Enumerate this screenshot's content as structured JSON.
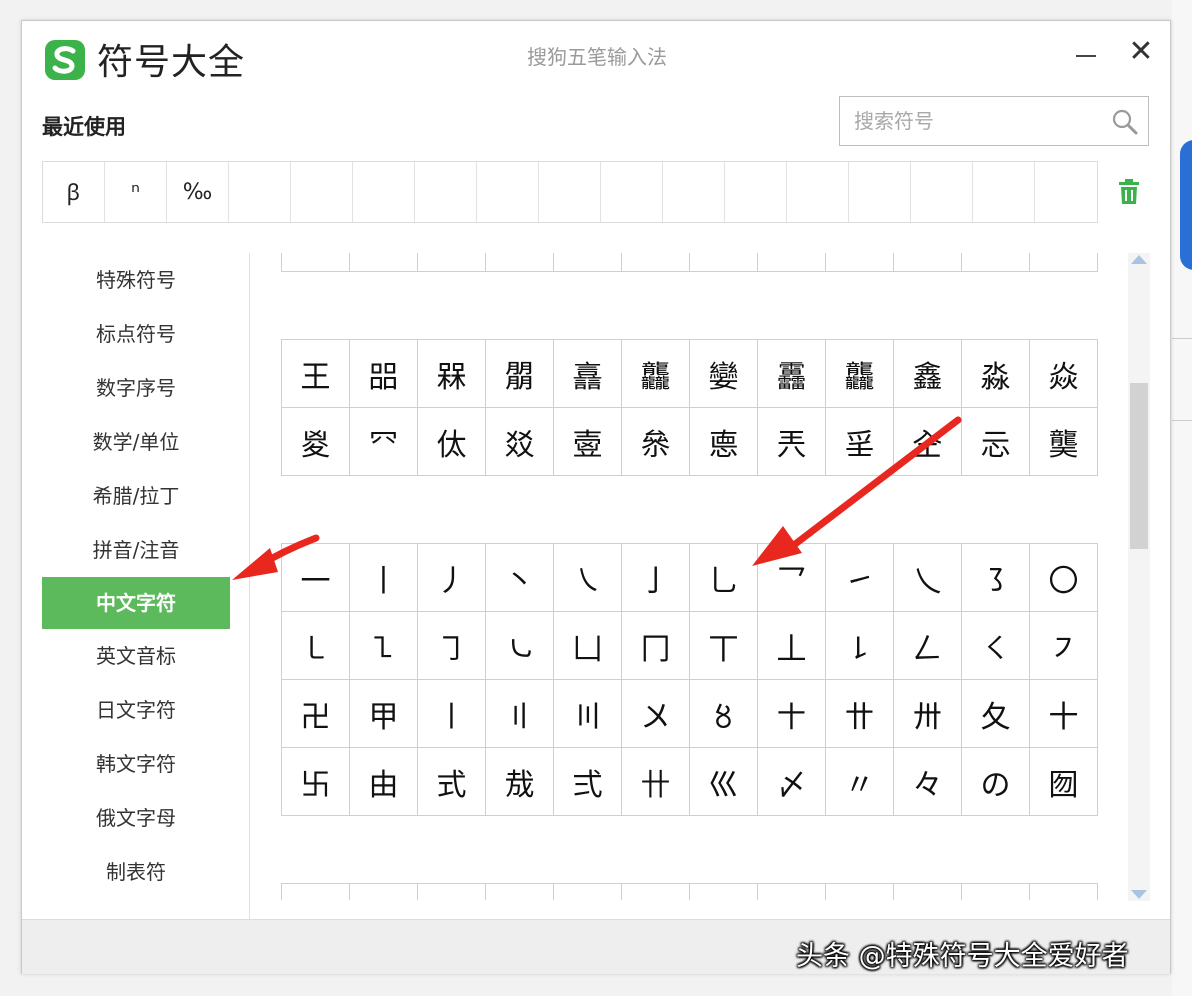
{
  "window": {
    "app_title": "符号大全",
    "ime_name": "搜狗五笔输入法"
  },
  "colors": {
    "accent": "#5cba5c",
    "logo_green": "#3cb34a",
    "arrow": "#e8281f"
  },
  "recent": {
    "title": "最近使用",
    "symbols": [
      "ꞵ",
      "ⁿ",
      "‰",
      "",
      "",
      "",
      "",
      "",
      "",
      "",
      "",
      "",
      "",
      "",
      "",
      "",
      ""
    ]
  },
  "search": {
    "placeholder": "搜索符号"
  },
  "sidebar": {
    "items": [
      {
        "label": "特殊符号"
      },
      {
        "label": "标点符号"
      },
      {
        "label": "数字序号"
      },
      {
        "label": "数学/单位"
      },
      {
        "label": "希腊/拉丁"
      },
      {
        "label": "拼音/注音"
      },
      {
        "label": "中文字符",
        "active": true
      },
      {
        "label": "英文音标"
      },
      {
        "label": "日文字符"
      },
      {
        "label": "韩文字符"
      },
      {
        "label": "俄文字母"
      },
      {
        "label": "制表符"
      }
    ]
  },
  "grid_rare": [
    "王",
    "㗊",
    "槑",
    "朤",
    "譶",
    "龘",
    "孌",
    "靐",
    "龘",
    "鑫",
    "淼",
    "焱",
    "㚇",
    "㓁",
    "㑀",
    "㸚",
    "㚃",
    "㕘",
    "㥁",
    "兲",
    "㸒",
    "㒰",
    "忈",
    "龑"
  ],
  "grid_strokes": [
    "一",
    "丨",
    "丿",
    "丶",
    "㇏",
    "亅",
    "乚",
    "乛",
    "㇀",
    "乀",
    "㇌",
    "〇",
    "㇄",
    "㇅",
    "㇆",
    "㇃",
    "凵",
    "冂",
    "丅",
    "丄",
    "㇙",
    "𠃋",
    "㇛",
    "㇇",
    "卍",
    "甲",
    "〡",
    "〢",
    "〣",
    "〤",
    "〥",
    "〸",
    "〹",
    "〺",
    "夂",
    "十",
    "卐",
    "由",
    "式",
    "㦲",
    "弍",
    "卄",
    "巛",
    "〆",
    "〃",
    "々",
    "の",
    "囫"
  ],
  "watermark": "头条 @特殊符号大全爱好者"
}
